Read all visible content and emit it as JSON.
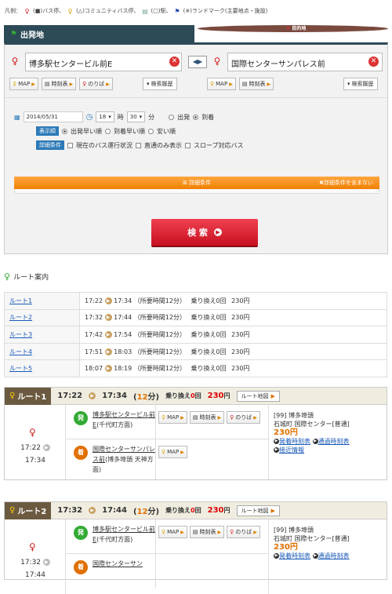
{
  "legend": {
    "prefix": "凡例：",
    "items": [
      "(■)バス停、",
      "(△)コミュニティバス停、",
      "(□)駅、",
      "(※)ランドマーク(主要地点・施設)"
    ]
  },
  "tabs": {
    "departure": "出発地",
    "arrival": "目的地"
  },
  "form": {
    "from_value": "博多駅センタービル前E",
    "to_value": "国際センターサンパレス前",
    "swap_label": "◀▶",
    "map": "MAP",
    "timetable": "時刻表",
    "platform": "のりば",
    "history": "検索履歴",
    "date": "2014/05/31",
    "hour": "18",
    "minute": "30",
    "hour_unit": "時",
    "minute_unit": "分",
    "depart": "出発",
    "arrive": "到着",
    "order_label": "表示順",
    "order_opts": [
      "出発早い順",
      "到着早い順",
      "安い順"
    ],
    "detail_label": "詳細条件",
    "detail_opts": [
      "現在のバス運行状況",
      "直通のみ表示",
      "スロープ対応バス"
    ],
    "bar_center": "詳細条件",
    "bar_right": "詳細条件を含まない",
    "search": "検 索"
  },
  "guide": {
    "title": "ルート案内"
  },
  "routes": [
    {
      "name": "ルート1",
      "dep": "17:22",
      "arr": "17:34",
      "dur": "（所要時間12分）",
      "tr": "乗り換え0回",
      "fare": "230円"
    },
    {
      "name": "ルート2",
      "dep": "17:32",
      "arr": "17:44",
      "dur": "（所要時間12分）",
      "tr": "乗り換え0回",
      "fare": "230円"
    },
    {
      "name": "ルート3",
      "dep": "17:42",
      "arr": "17:54",
      "dur": "（所要時間12分）",
      "tr": "乗り換え0回",
      "fare": "230円"
    },
    {
      "name": "ルート4",
      "dep": "17:51",
      "arr": "18:03",
      "dur": "（所要時間12分）",
      "tr": "乗り換え0回",
      "fare": "230円"
    },
    {
      "name": "ルート5",
      "dep": "18:07",
      "arr": "18:19",
      "dur": "（所要時間12分）",
      "tr": "乗り換え0回",
      "fare": "230円"
    }
  ],
  "details": [
    {
      "tag": "ルート1",
      "dep": "17:22",
      "arr": "17:34",
      "min": "12",
      "min_unit": "分",
      "transfer_pre": "乗り換え",
      "transfer": "0",
      "transfer_unit": "回",
      "fare": "230",
      "fare_unit": "円",
      "map_btn": "ルート地図",
      "t1": "17:22",
      "t2": "17:34",
      "dep_badge": "発",
      "dep_stop": "博多駅センタービル前E",
      "dep_dir": "(千代町方面)",
      "arr_badge": "着",
      "arr_stop": "国際センターサンパレス前",
      "arr_dir": "(博多埠頭 天神方面)",
      "line": "[99] 博多埠頭",
      "via": "石城町 国際センター[普通]",
      "fare2": "230円",
      "link1": "発着時刻表",
      "link2": "通過時刻表",
      "link3": "接近情報"
    },
    {
      "tag": "ルート2",
      "dep": "17:32",
      "arr": "17:44",
      "min": "12",
      "min_unit": "分",
      "transfer_pre": "乗り換え",
      "transfer": "0",
      "transfer_unit": "回",
      "fare": "230",
      "fare_unit": "円",
      "map_btn": "ルート地図",
      "t1": "17:32",
      "t2": "17:44",
      "dep_badge": "発",
      "dep_stop": "博多駅センタービル前E",
      "dep_dir": "(千代町方面)",
      "arr_badge": "着",
      "arr_stop": "国際センターサン",
      "line": "[99] 博多埠頭",
      "via": "石城町 国際センター[普通]",
      "fare2": "230円",
      "link1": "発着時刻表",
      "link2": "通過時刻表"
    }
  ]
}
